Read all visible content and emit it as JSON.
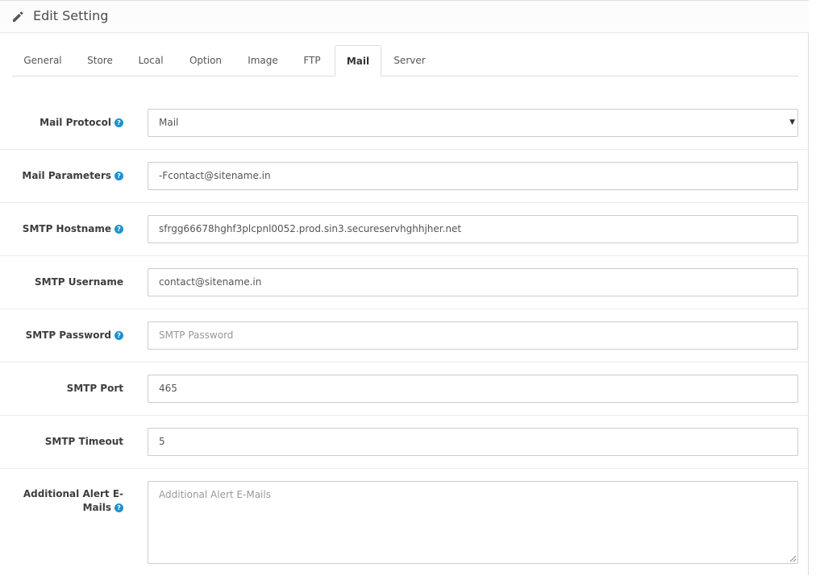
{
  "header": {
    "title": "Edit Setting",
    "icon": "pencil-icon"
  },
  "tabs": [
    {
      "label": "General",
      "active": false
    },
    {
      "label": "Store",
      "active": false
    },
    {
      "label": "Local",
      "active": false
    },
    {
      "label": "Option",
      "active": false
    },
    {
      "label": "Image",
      "active": false
    },
    {
      "label": "FTP",
      "active": false
    },
    {
      "label": "Mail",
      "active": true
    },
    {
      "label": "Server",
      "active": false
    }
  ],
  "fields": {
    "mail_protocol": {
      "label": "Mail Protocol",
      "value": "Mail",
      "help": true
    },
    "mail_parameters": {
      "label": "Mail Parameters",
      "value": "-Fcontact@sitename.in",
      "help": true
    },
    "smtp_hostname": {
      "label": "SMTP Hostname",
      "value": "sfrgg66678hghf3plcpnl0052.prod.sin3.secureservhghhjher.net",
      "help": true
    },
    "smtp_username": {
      "label": "SMTP Username",
      "value": "contact@sitename.in",
      "help": false
    },
    "smtp_password": {
      "label": "SMTP Password",
      "value": "",
      "placeholder": "SMTP Password",
      "help": true
    },
    "smtp_port": {
      "label": "SMTP Port",
      "value": "465",
      "help": false
    },
    "smtp_timeout": {
      "label": "SMTP Timeout",
      "value": "5",
      "help": false
    },
    "alert_emails": {
      "label_line1": "Additional Alert E-",
      "label_line2": "Mails",
      "value": "",
      "placeholder": "Additional Alert E-Mails",
      "help": true
    }
  },
  "help_glyph": "?",
  "colors": {
    "help_icon": "#1e91cf",
    "border": "#cccccc"
  }
}
